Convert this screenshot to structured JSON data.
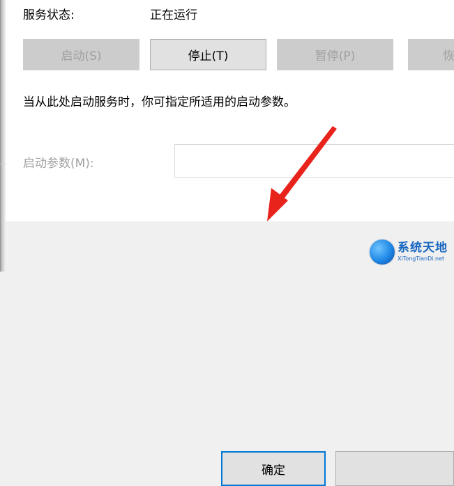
{
  "service": {
    "status_label": "服务状态:",
    "status_value": "正在运行"
  },
  "buttons": {
    "start": "启动(S)",
    "stop": "停止(T)",
    "pause": "暂停(P)",
    "resume": "恢"
  },
  "hint_text": "当从此处启动服务时，你可指定所适用的启动参数。",
  "start_params": {
    "label": "启动参数(M):",
    "value": ""
  },
  "footer": {
    "ok": "确定"
  },
  "watermark": {
    "main": "系统天地",
    "sub": "XiTongTianDi.net"
  },
  "colors": {
    "annotation_arrow": "#e8231c",
    "focus_border": "#0078d7"
  }
}
